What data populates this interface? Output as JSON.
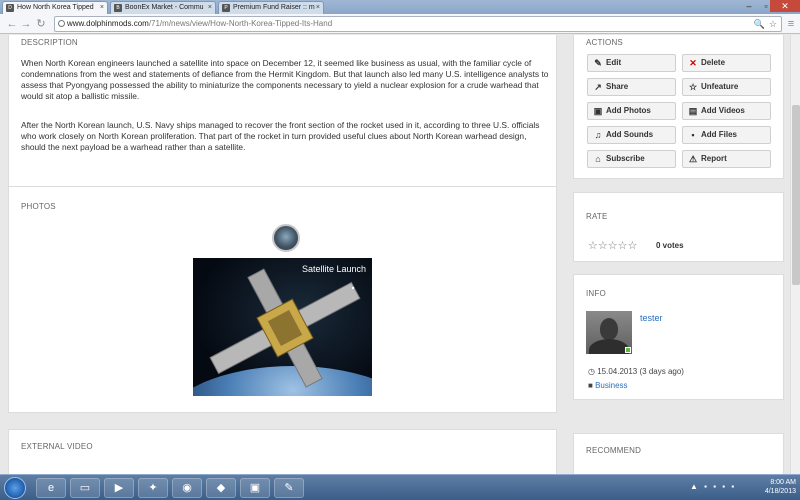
{
  "browser": {
    "tabs": [
      {
        "label": "How North Korea Tipped",
        "active": true
      },
      {
        "label": "BoonEx Market - Commu",
        "active": false
      },
      {
        "label": "Premium Fund Raiser :: m",
        "active": false
      }
    ],
    "url_host": "www.dolphinmods.com",
    "url_path": "/71/m/news/view/How-North-Korea-Tipped-Its-Hand"
  },
  "description": {
    "title": "DESCRIPTION",
    "p1": "When North Korean engineers launched a satellite into space on December 12, it seemed like business as usual, with the familiar cycle of condemnations from the west and statements of defiance from the Hermit Kingdom. But that launch also led many U.S. intelligence analysts to assess that Pyongyang possessed the ability to miniaturize the components necessary to yield a nuclear explosion for a crude warhead that would sit atop a ballistic missile.",
    "p2": "After the North Korean launch, U.S. Navy ships managed to recover the front section of the rocket used in it, according to three U.S. officials who work closely on North Korean proliferation. That part of the rocket in turn provided useful clues about North Korean warhead design, should the next payload be a warhead rather than a satellite."
  },
  "photos": {
    "title": "PHOTOS",
    "caption": "Satellite Launch"
  },
  "external_video": {
    "title": "EXTERNAL VIDEO"
  },
  "actions": {
    "title": "ACTIONS",
    "edit": "Edit",
    "delete": "Delete",
    "share": "Share",
    "unfeature": "Unfeature",
    "add_photos": "Add Photos",
    "add_videos": "Add Videos",
    "add_sounds": "Add Sounds",
    "add_files": "Add Files",
    "subscribe": "Subscribe",
    "report": "Report"
  },
  "rate": {
    "title": "RATE",
    "stars": "☆☆☆☆☆",
    "votes": "0 votes",
    "rating": 0
  },
  "info": {
    "title": "INFO",
    "username": "tester",
    "date": "15.04.2013 (3 days ago)",
    "category": "Business"
  },
  "recommend": {
    "title": "RECOMMEND"
  },
  "taskbar": {
    "time": "8:00 AM",
    "date": "4/18/2013"
  }
}
